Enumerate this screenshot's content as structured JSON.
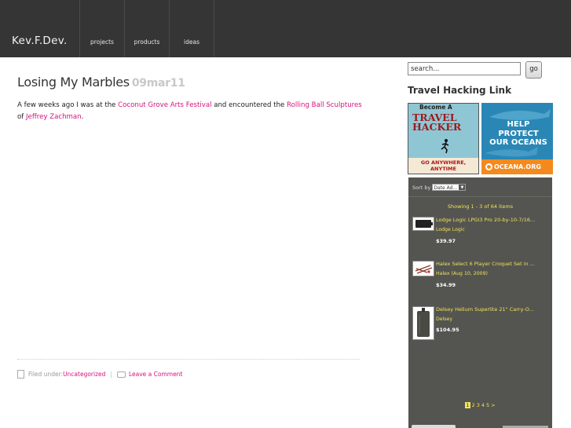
{
  "header": {
    "brand": "Kev.F.Dev.",
    "nav": [
      "projects",
      "products",
      "ideas"
    ]
  },
  "post": {
    "title": "Losing My Marbles",
    "date": "09mar11",
    "body": {
      "t1": "A few weeks ago I was at the ",
      "link1": "Coconut Grove Arts Festival",
      "t2": " and encountered the ",
      "link2": "Rolling Ball Sculptures",
      "t3": " of ",
      "link3": "Jeffrey Zachman",
      "t4": "."
    },
    "meta": {
      "filed_label": "Filed under: ",
      "category": "Uncategorized",
      "separator": "|",
      "comment_link": "Leave a Comment"
    }
  },
  "sidebar": {
    "search_placeholder": "search...",
    "go_label": "go",
    "heading": "Travel Hacking Link",
    "ad1": {
      "line1": "Become A",
      "line2": "TRAVEL",
      "line3": "HACKER",
      "foot1": "GO ANYWHERE,",
      "foot2": "ANYTIME"
    },
    "ad2": {
      "line1": "HELP PROTECT",
      "line2": "OUR OCEANS",
      "foot": "OCEANA.ORG"
    },
    "widget": {
      "sort_label": "Sort by",
      "sort_value": "Date Ad...",
      "showing": "Showing 1 - 3 of 64 items",
      "products": [
        {
          "title": "Lodge Logic LPGI3 Pro 20-by-10-7/16...",
          "brand": "Lodge Logic",
          "price": "$39.97"
        },
        {
          "title": "Halex Select 6 Player Croquet Set in ...",
          "brand": "Halex (Aug 10, 2009)",
          "price": "$34.99"
        },
        {
          "title": "Delsey Helium Superlite 21\" Carry-O...",
          "brand": "Delsey",
          "price": "$104.95"
        }
      ],
      "pager": {
        "current": "1",
        "pages": [
          "2",
          "3",
          "4",
          "5",
          ">"
        ]
      }
    }
  }
}
